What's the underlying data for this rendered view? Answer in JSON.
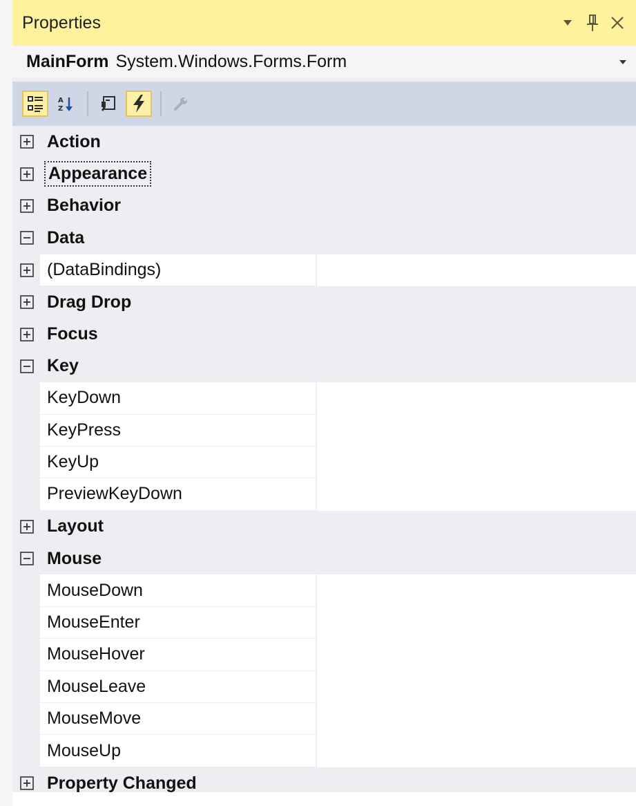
{
  "window": {
    "title": "Properties"
  },
  "object_selector": {
    "name": "MainForm",
    "type": "System.Windows.Forms.Form"
  },
  "toolbar": {
    "buttons": [
      {
        "id": "categorized",
        "icon": "categorized-icon",
        "active": true
      },
      {
        "id": "alphabetical",
        "icon": "alphabetical-sort-icon",
        "active": false
      },
      {
        "id": "properties",
        "icon": "properties-icon",
        "active": false
      },
      {
        "id": "events",
        "icon": "lightning-bolt-icon",
        "active": true
      },
      {
        "id": "property-pages",
        "icon": "wrench-icon",
        "active": false,
        "disabled": true
      }
    ]
  },
  "grid": {
    "rows": [
      {
        "kind": "category",
        "label": "Action",
        "expanded": false
      },
      {
        "kind": "category",
        "label": "Appearance",
        "expanded": false,
        "focused": true
      },
      {
        "kind": "category",
        "label": "Behavior",
        "expanded": false
      },
      {
        "kind": "category",
        "label": "Data",
        "expanded": true
      },
      {
        "kind": "property",
        "label": "(DataBindings)",
        "expandable": true,
        "value": ""
      },
      {
        "kind": "category",
        "label": "Drag Drop",
        "expanded": false
      },
      {
        "kind": "category",
        "label": "Focus",
        "expanded": false
      },
      {
        "kind": "category",
        "label": "Key",
        "expanded": true
      },
      {
        "kind": "property",
        "label": "KeyDown",
        "value": ""
      },
      {
        "kind": "property",
        "label": "KeyPress",
        "value": ""
      },
      {
        "kind": "property",
        "label": "KeyUp",
        "value": ""
      },
      {
        "kind": "property",
        "label": "PreviewKeyDown",
        "value": ""
      },
      {
        "kind": "category",
        "label": "Layout",
        "expanded": false
      },
      {
        "kind": "category",
        "label": "Mouse",
        "expanded": true
      },
      {
        "kind": "property",
        "label": "MouseDown",
        "value": ""
      },
      {
        "kind": "property",
        "label": "MouseEnter",
        "value": ""
      },
      {
        "kind": "property",
        "label": "MouseHover",
        "value": ""
      },
      {
        "kind": "property",
        "label": "MouseLeave",
        "value": ""
      },
      {
        "kind": "property",
        "label": "MouseMove",
        "value": ""
      },
      {
        "kind": "property",
        "label": "MouseUp",
        "value": ""
      },
      {
        "kind": "category",
        "label": "Property Changed",
        "expanded": false
      }
    ]
  },
  "colors": {
    "title_bar": "#fff29d",
    "toolbar": "#cfd6e5",
    "active_tool": "#fff0a8",
    "grid_background": "#eeeef2",
    "cell_background": "#ffffff"
  }
}
